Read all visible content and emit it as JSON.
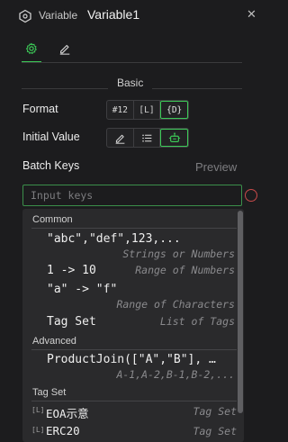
{
  "header": {
    "icon": "hexagon-variable-icon",
    "kind_label": "Variable",
    "name": "Variable1",
    "close_icon": "close-icon"
  },
  "tabs": [
    {
      "icon": "gear-icon",
      "active": true
    },
    {
      "icon": "pencil-icon",
      "active": false
    }
  ],
  "section": {
    "title": "Basic"
  },
  "format": {
    "label": "Format",
    "options": [
      "#12",
      "[L]",
      "{D}"
    ],
    "active_index": 2
  },
  "initial_value": {
    "label": "Initial Value",
    "options": [
      "pencil-icon",
      "list-icon",
      "robot-icon"
    ],
    "active_index": 2
  },
  "batch_keys": {
    "label": "Batch Keys",
    "preview_label": "Preview",
    "input": {
      "placeholder": "Input keys",
      "value": ""
    }
  },
  "dropdown": {
    "groups": [
      {
        "title": "Common",
        "items": [
          {
            "main": "\"abc\",\"def\",123,...",
            "sub": "Strings or Numbers"
          },
          {
            "main": "1 -> 10",
            "sub": "Range of Numbers"
          },
          {
            "main": "\"a\" -> \"f\"",
            "sub": "Range of Characters"
          },
          {
            "main": "Tag Set",
            "sub": "List of Tags"
          }
        ]
      },
      {
        "title": "Advanced",
        "items": [
          {
            "main": "ProductJoin([\"A\",\"B\"], …",
            "sub": "A-1,A-2,B-1,B-2,..."
          }
        ]
      },
      {
        "title": "Tag Set",
        "items": [
          {
            "icon": "[L]",
            "name": "EOA示意",
            "kind": "Tag Set"
          },
          {
            "icon": "[L]",
            "name": "ERC20",
            "kind": "Tag Set"
          }
        ]
      }
    ]
  },
  "colors": {
    "accent": "#3cc957",
    "background": "#1c1c1e",
    "dropdown_bg": "#2a2a2c",
    "error_edge": "#c74a4a"
  }
}
